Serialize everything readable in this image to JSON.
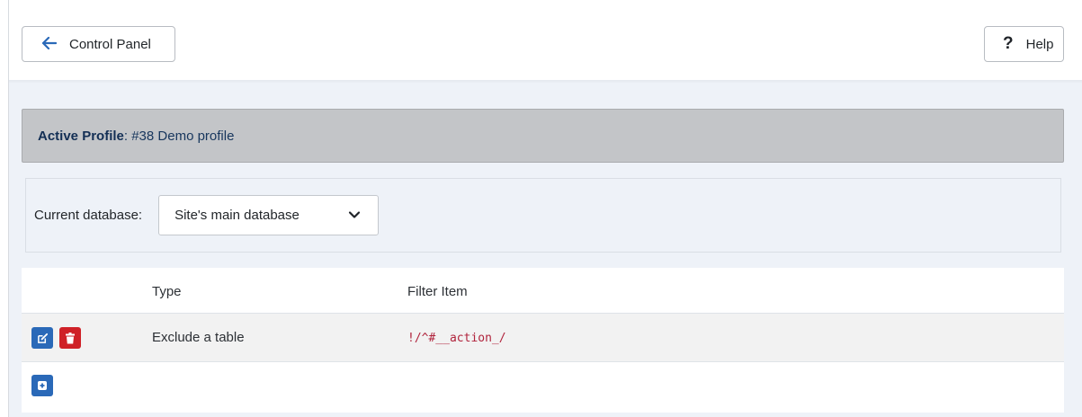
{
  "toolbar": {
    "back_label": "Control Panel",
    "help_label": "Help",
    "help_glyph": "?"
  },
  "profile": {
    "label": "Active Profile",
    "value": ": #38 Demo profile"
  },
  "database": {
    "label": "Current database:",
    "selected": "Site's main database"
  },
  "table": {
    "columns": [
      "Type",
      "Filter Item"
    ],
    "rows": [
      {
        "type": "Exclude a table",
        "filter": "!/^#__action_/"
      }
    ]
  },
  "colors": {
    "primary": "#2a69b8",
    "danger": "#cf2127",
    "code": "#b0233c",
    "profile_bg": "#c3c5c8"
  },
  "icons": [
    "arrow-left-icon",
    "question-icon",
    "chevron-down-icon",
    "edit-icon",
    "trash-icon",
    "plus-icon"
  ]
}
